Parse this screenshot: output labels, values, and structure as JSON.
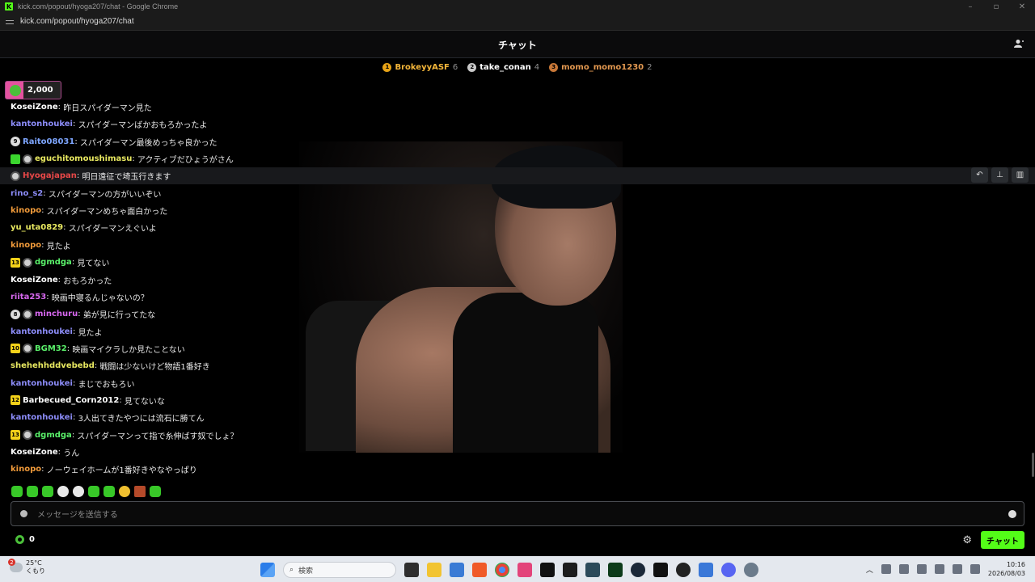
{
  "browser": {
    "window_title": "kick.com/popout/hyoga207/chat - Google Chrome",
    "favicon_letter": "K",
    "url": "kick.com/popout/hyoga207/chat"
  },
  "header": {
    "title": "チャット"
  },
  "leaderboard": [
    {
      "rank": "1",
      "name": "BrokeyyASF",
      "count": "6",
      "color": "#e8a417",
      "name_color": "#f4b63a"
    },
    {
      "rank": "2",
      "name": "take_conan",
      "count": "4",
      "color": "#c8c8c8",
      "name_color": "#ffffff"
    },
    {
      "rank": "3",
      "name": "momo_momo1230",
      "count": "2",
      "color": "#c87838",
      "name_color": "#e29850"
    }
  ],
  "tip": {
    "amount": "2,000"
  },
  "messages": [
    {
      "badges": [],
      "user": "KoseiZone",
      "user_color": "#ffffff",
      "text": "昨日スパイダーマン見た"
    },
    {
      "badges": [],
      "user": "kantonhoukei",
      "user_color": "#8c8cf8",
      "text": "スパイダーマンばかおもろかったよ"
    },
    {
      "badges": [
        {
          "type": "circ",
          "label": "9"
        }
      ],
      "user": "Raito08031",
      "user_color": "#7ea6ff",
      "text": "スパイダーマン最後めっちゃ良かった"
    },
    {
      "badges": [
        {
          "type": "gift",
          "label": ""
        },
        {
          "type": "avatar",
          "label": ""
        }
      ],
      "user": "eguchitomoushimasu",
      "user_color": "#e8e860",
      "text": "アクティブだひょうがさん"
    },
    {
      "badges": [
        {
          "type": "avatar",
          "label": ""
        }
      ],
      "user": "Hyogajapan",
      "user_color": "#e84848",
      "text": "明日遠征で埼玉行きます",
      "highlight": true
    },
    {
      "badges": [],
      "user": "rino_s2",
      "user_color": "#8c8cf8",
      "text": "スパイダーマンの方がいいぞい"
    },
    {
      "badges": [],
      "user": "kinopo",
      "user_color": "#f09a3a",
      "text": "スパイダーマンめちゃ面白かった"
    },
    {
      "badges": [],
      "user": "yu_uta0829",
      "user_color": "#e8e860",
      "text": "スパイダーマンえぐいよ"
    },
    {
      "badges": [],
      "user": "kinopo",
      "user_color": "#f09a3a",
      "text": "見たよ"
    },
    {
      "badges": [
        {
          "type": "sub",
          "label": "13"
        },
        {
          "type": "avatar",
          "label": ""
        }
      ],
      "user": "dgmdga",
      "user_color": "#5af06a",
      "text": "見てない"
    },
    {
      "badges": [],
      "user": "KoseiZone",
      "user_color": "#ffffff",
      "text": "おもろかった"
    },
    {
      "badges": [],
      "user": "riita253",
      "user_color": "#d868f0",
      "text": "映画中寝るんじゃないの？"
    },
    {
      "badges": [
        {
          "type": "circ",
          "label": "8"
        },
        {
          "type": "avatar",
          "label": ""
        }
      ],
      "user": "minchuru",
      "user_color": "#d868f0",
      "text": "弟が見に行ってたな"
    },
    {
      "badges": [],
      "user": "kantonhoukei",
      "user_color": "#8c8cf8",
      "text": "見たよ"
    },
    {
      "badges": [
        {
          "type": "sub",
          "label": "10"
        },
        {
          "type": "avatar",
          "label": ""
        }
      ],
      "user": "BGM32",
      "user_color": "#5af06a",
      "text": "映画マイクラしか見たことない"
    },
    {
      "badges": [],
      "user": "shehehhddvebebd",
      "user_color": "#e8e860",
      "text": "戦闘は少ないけど物語1番好き"
    },
    {
      "badges": [],
      "user": "kantonhoukei",
      "user_color": "#8c8cf8",
      "text": "まじでおもろい"
    },
    {
      "badges": [
        {
          "type": "sub",
          "label": "12"
        }
      ],
      "user": "Barbecued_Corn2012",
      "user_color": "#ffffff",
      "text": "見てないな"
    },
    {
      "badges": [],
      "user": "kantonhoukei",
      "user_color": "#8c8cf8",
      "text": "3人出てきたやつには流石に勝てん"
    },
    {
      "badges": [
        {
          "type": "sub",
          "label": "13"
        },
        {
          "type": "avatar",
          "label": ""
        }
      ],
      "user": "dgmdga",
      "user_color": "#5af06a",
      "text": "スパイダーマンって指で糸伸ばす奴でしょ？"
    },
    {
      "badges": [],
      "user": "KoseiZone",
      "user_color": "#ffffff",
      "text": "うん"
    },
    {
      "badges": [],
      "user": "kinopo",
      "user_color": "#f09a3a",
      "text": "ノーウェイホームが1番好きやなやっぱり"
    }
  ],
  "message_separator": ": ",
  "input": {
    "placeholder": "メッセージを送信する"
  },
  "footer": {
    "points": "0",
    "send_label": "チャット"
  },
  "taskbar": {
    "weather_temp": "25°C",
    "weather_desc": "くもり",
    "weather_alert": "2",
    "search_placeholder": "検索",
    "time": "10:16",
    "date": "2026/08/03"
  }
}
